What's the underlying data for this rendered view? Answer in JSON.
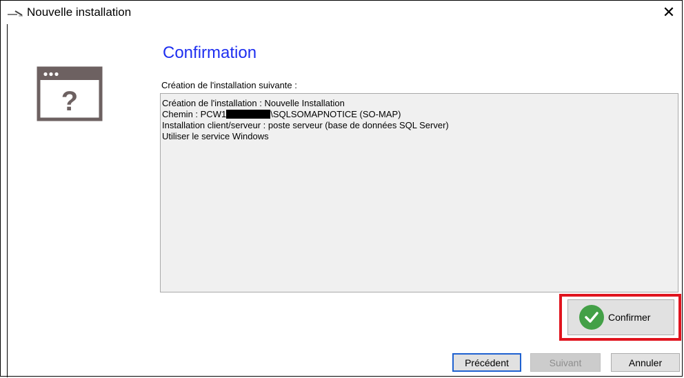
{
  "window": {
    "title": "Nouvelle installation",
    "close_symbol": "✕",
    "app_icon": "wizard-pen-icon"
  },
  "page": {
    "heading": "Confirmation",
    "illustration_icon": "window-question-icon",
    "illustration_symbol": "?",
    "summary_label": "Création de l'installation suivante :",
    "summary": {
      "line1": "Création de l'installation : Nouvelle Installation",
      "line2_prefix": "Chemin : PCW1",
      "line2_suffix": "\\SQLSOMAPNOTICE (SO-MAP)",
      "line3": "Installation client/serveur : poste serveur (base de données SQL Server)",
      "line4": "Utiliser le service Windows"
    }
  },
  "actions": {
    "confirm_label": "Confirmer",
    "confirm_icon": "checkmark-circle-icon",
    "previous_label": "Précédent",
    "next_label": "Suivant",
    "next_enabled": false,
    "cancel_label": "Annuler"
  },
  "colors": {
    "heading": "#1e2ff0",
    "highlight_border": "#e0141e",
    "check_green": "#43a047",
    "focus_border": "#1e61d0"
  }
}
